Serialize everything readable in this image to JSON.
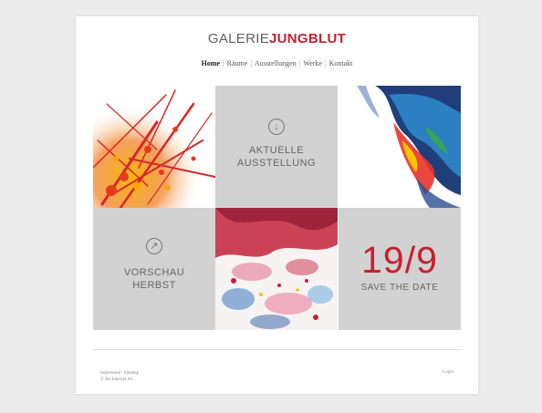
{
  "site": {
    "logo_light": "GALERIE",
    "logo_bold": "JUNGBLUT"
  },
  "nav": {
    "items": [
      "Home",
      "Räume",
      "Ausstellungen",
      "Werke",
      "Kontakt"
    ],
    "separator": "|",
    "active_index": 0
  },
  "tiles": {
    "current_exhibition": {
      "line1": "AKTUELLE",
      "line2": "AUSSTELLUNG",
      "icon": "arrow-down-circle-icon"
    },
    "preview": {
      "line1": "VORSCHAU",
      "line2": "HERBST",
      "icon": "arrow-up-right-circle-icon"
    },
    "save_date": {
      "date": "19/9",
      "label": "SAVE THE DATE"
    }
  },
  "footer": {
    "imprint": "Impressum",
    "sitemap": "Sitemap",
    "separator": "|",
    "copyright": "© der Internet AG",
    "login": "Login"
  },
  "colors": {
    "accent": "#c8202d",
    "tile_gray": "#d2d2d2",
    "background": "#ececec"
  }
}
